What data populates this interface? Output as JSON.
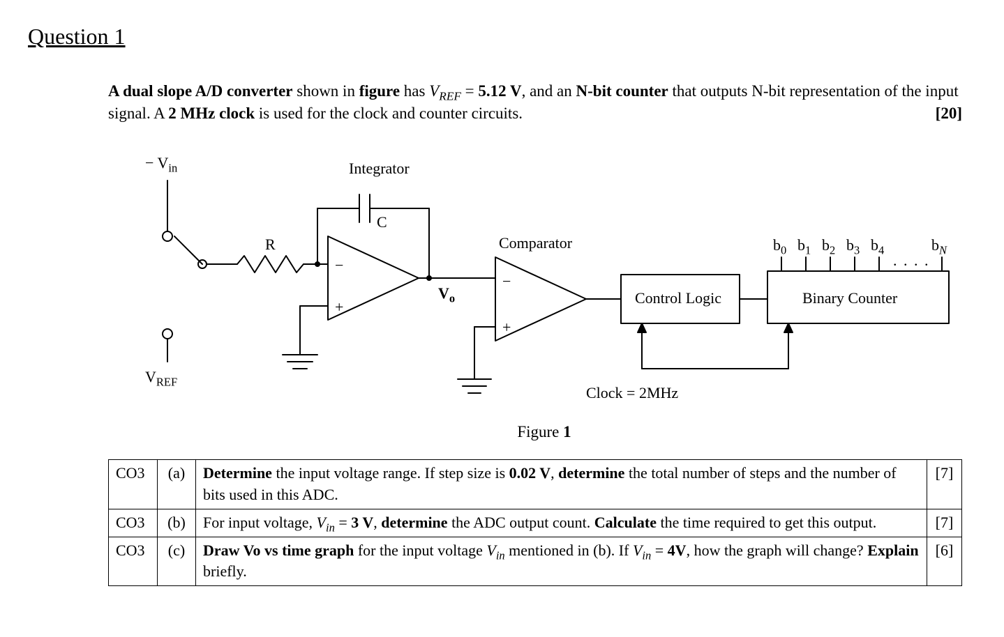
{
  "title": "Question 1",
  "intro": {
    "p1": "A dual slope A/D converter",
    "p2": " shown in ",
    "p3": "figure",
    "p4": "   has ",
    "p5_vref": "V",
    "p5_refsub": "REF",
    "p6": " = ",
    "p7": "5.12 V",
    "p8": ", and an ",
    "p9": "N-bit counter",
    "p10": " that outputs N-bit representation of the input signal. A ",
    "p11": "2 MHz clock",
    "p12": " is used for the clock and counter circuits.",
    "marks": "[20]"
  },
  "fig": {
    "vin": "− V",
    "vin_sub": "in",
    "integrator": "Integrator",
    "C": "C",
    "R": "R",
    "Vo": "V",
    "Vo_sub": "o",
    "comparator": "Comparator",
    "vref": "V",
    "vref_sub": "REF",
    "control": "Control Logic",
    "counter": "Binary Counter",
    "clock": "Clock = 2MHz",
    "bits": {
      "b0": "b",
      "s0": "0",
      "b1": "b",
      "s1": "1",
      "b2": "b",
      "s2": "2",
      "b3": "b",
      "s3": "3",
      "b4": "b",
      "s4": "4",
      "bn": "b",
      "sn": "N",
      "dots": ". . . ."
    },
    "caption_a": "Figure ",
    "caption_b": "1",
    "minus": "−",
    "plus": "+"
  },
  "rows": [
    {
      "co": "CO3",
      "part": "(a)",
      "text_a": "Determine",
      "text_b": " the input voltage range. If step size is ",
      "text_c": "0.02 V",
      "text_d": ", ",
      "text_e": "determine",
      "text_f": " the total number of steps and the number of bits used in this ADC.",
      "mk": "[7]"
    },
    {
      "co": "CO3",
      "part": "(b)",
      "text_a": "For input voltage, ",
      "vin": "V",
      "vinsub": "in",
      "text_b": " = ",
      "text_c": "3 V",
      "text_d": ", ",
      "text_e": "determine",
      "text_f": " the ADC output count. ",
      "text_g": "Calculate",
      "text_h": " the time required to get this output.",
      "mk": "[7]"
    },
    {
      "co": "CO3",
      "part": "(c)",
      "text_a": "Draw Vo vs time graph",
      "text_b": " for the input voltage ",
      "vin": "V",
      "vinsub": "in",
      "text_c": " mentioned in (b). If ",
      "vin2": "V",
      "vinsub2": "in",
      "text_d": " = ",
      "text_e": "4V",
      "text_f": ", how the graph will change? ",
      "text_g": "Explain",
      "text_h": " briefly.",
      "mk": "[6]"
    }
  ]
}
